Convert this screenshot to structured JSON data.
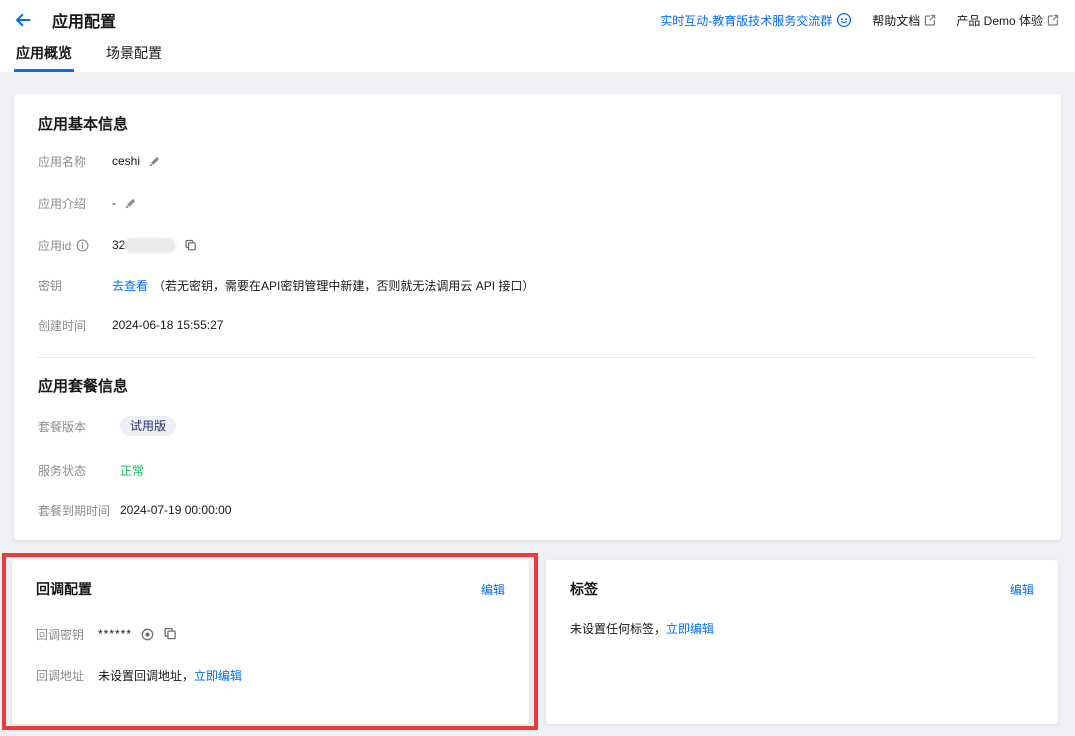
{
  "header": {
    "title": "应用配置",
    "group_link": "实时互动-教育版技术服务交流群",
    "help_link": "帮助文档",
    "demo_link": "产品 Demo 体验"
  },
  "tabs": {
    "overview": "应用概览",
    "scene": "场景配置"
  },
  "basic": {
    "title": "应用基本信息",
    "name_label": "应用名称",
    "name_value": "ceshi",
    "intro_label": "应用介绍",
    "intro_value": "-",
    "id_label": "应用id",
    "id_value_visible": "32",
    "key_label": "密钥",
    "key_link": "去查看",
    "key_note": "（若无密钥，需要在API密钥管理中新建，否则就无法调用云 API 接口）",
    "created_label": "创建时间",
    "created_value": "2024-06-18 15:55:27"
  },
  "package": {
    "title": "应用套餐信息",
    "version_label": "套餐版本",
    "version_value": "试用版",
    "status_label": "服务状态",
    "status_value": "正常",
    "expire_label": "套餐到期时间",
    "expire_value": "2024-07-19 00:00:00"
  },
  "callback": {
    "title": "回调配置",
    "edit_link": "编辑",
    "secret_label": "回调密钥",
    "secret_value": "******",
    "address_label": "回调地址",
    "address_text": "未设置回调地址，",
    "address_link": "立即编辑"
  },
  "tags": {
    "title": "标签",
    "edit_link": "编辑",
    "empty_text": "未设置任何标签，",
    "empty_link": "立即编辑"
  },
  "colors": {
    "accent_blue": "#006eff",
    "success_green": "#0abf5b",
    "highlight_red": "#ee3a3a",
    "badge_bg": "#eef0f6",
    "badge_text": "#243266",
    "page_bg": "#f0f1f5"
  }
}
